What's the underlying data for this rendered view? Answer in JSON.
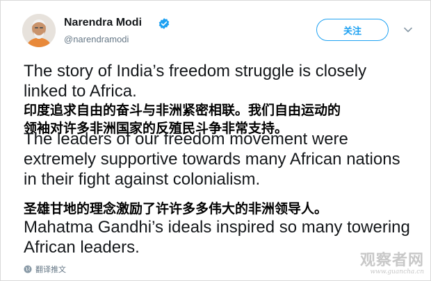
{
  "author": {
    "name": "Narendra Modi",
    "handle": "@narendramodi",
    "verified_icon": "verified-badge-icon"
  },
  "actions": {
    "follow_label": "关注",
    "more_icon": "chevron-down-icon"
  },
  "tweet": {
    "en_1": "The story of India’s freedom struggle is closely linked to Africa.",
    "zh_1_line1": "印度追求自由的奋斗与非洲紧密相联。我们自由运动的",
    "zh_1_line2": "领袖对许多非洲国家的反殖民斗争非常支持。",
    "en_2": "The leaders of our freedom movement were extremely supportive towards many African nations in their fight against colonialism.",
    "zh_2": "圣雄甘地的理念激励了许许多多伟大的非洲领导人。",
    "en_3": "Mahatma Gandhi’s ideals inspired so many towering African leaders."
  },
  "footer": {
    "translate_label": "翻译推文",
    "translate_icon": "globe-icon"
  },
  "watermark": {
    "main": "观察者网",
    "sub": "www.guancha.cn"
  },
  "colors": {
    "accent": "#1da1f2",
    "text": "#14171a",
    "muted": "#657786"
  }
}
